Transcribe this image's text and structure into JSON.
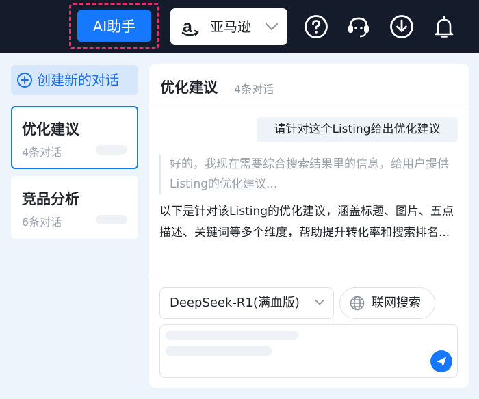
{
  "topbar": {
    "ai_button_label": "AI助手",
    "store_label": "亚马逊",
    "icons": [
      "help-icon",
      "customer-service-icon",
      "download-icon",
      "bell-icon"
    ]
  },
  "sidebar": {
    "new_chat_label": "创建新的对话",
    "conversations": [
      {
        "title": "优化建议",
        "count": "4条对话",
        "active": true
      },
      {
        "title": "竞品分析",
        "count": "6条对话",
        "active": false
      }
    ]
  },
  "chat": {
    "title": "优化建议",
    "count": "4条对话",
    "user_message": "请针对这个Listing给出优化建议",
    "thinking_text": "好的，我现在需要综合搜索结果里的信息，给用户提供Listing的优化建议...",
    "answer_text": "以下是针对该Listing的优化建议，涵盖标题、图片、五点描述、关键词等多个维度，帮助提升转化率和搜索排名...",
    "model_label": "DeepSeek-R1(满血版)",
    "web_search_label": "联网搜索"
  },
  "colors": {
    "topbar_bg": "#141c2c",
    "accent": "#1677ff",
    "highlight_border": "#e0336c",
    "page_bg": "#eef4fc"
  }
}
